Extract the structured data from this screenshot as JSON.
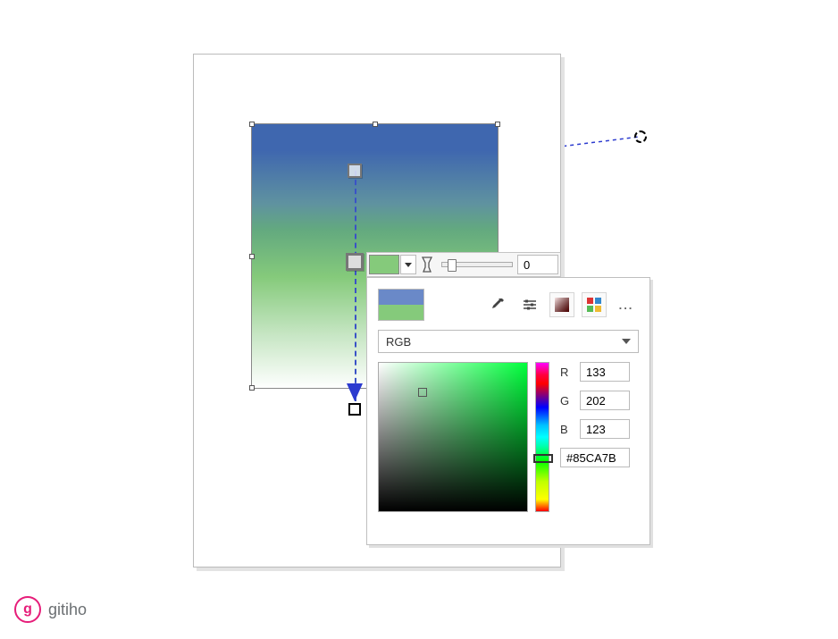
{
  "brand": {
    "initial": "g",
    "name": "gitiho"
  },
  "transparency": {
    "value": "0"
  },
  "colorModel": {
    "selected": "RGB"
  },
  "rgb": {
    "r": "133",
    "g": "202",
    "b": "123",
    "hex": "#85CA7B"
  },
  "labels": {
    "R": "R",
    "G": "G",
    "B": "B"
  },
  "gradient": {
    "startColor": "#3f67af",
    "endColor": "#ffffff",
    "midColor": "#85ca7b"
  },
  "icons": {
    "eyedropper": "eyedropper",
    "sliders": "sliders",
    "swatch": "swatch",
    "palette": "palette",
    "more": "..."
  }
}
